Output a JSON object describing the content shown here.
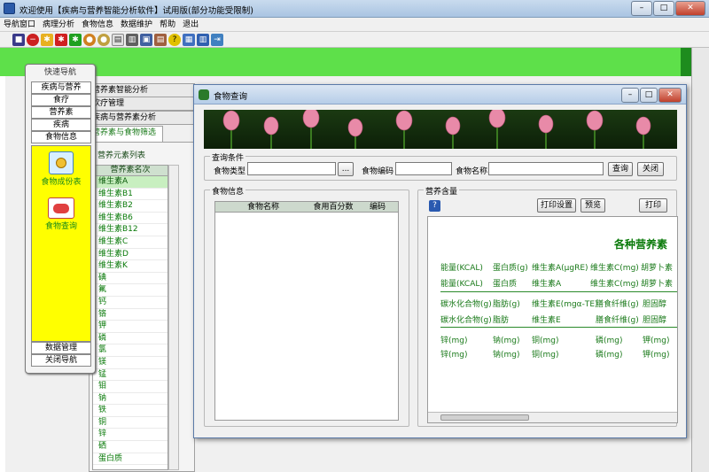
{
  "window": {
    "title": "欢迎使用【疾病与营养智能分析软件】试用版(部分功能受限制)"
  },
  "menu": [
    "导航窗口",
    "病理分析",
    "食物信息",
    "数据维护",
    "帮助",
    "退出"
  ],
  "background": {
    "tab1": "营养素智能分析",
    "tab2": "饮疗管理",
    "tab3": "疾病与营养素分析",
    "tab4": "营养素与食物筛选",
    "list_title": "营养元素列表",
    "list_header": "营养素名次",
    "items": [
      "维生素A",
      "维生素B1",
      "维生素B2",
      "维生素B6",
      "维生素B12",
      "维生素C",
      "维生素D",
      "维生素K",
      "碘",
      "氟",
      "钙",
      "铬",
      "钾",
      "磷",
      "氯",
      "镁",
      "锰",
      "钼",
      "钠",
      "铁",
      "铜",
      "锌",
      "硒",
      "蛋白质"
    ]
  },
  "quicknav": {
    "title": "快速导航",
    "sections": [
      "疾病与营养",
      "食疗",
      "营养素",
      "疾病",
      "食物信息"
    ],
    "items": [
      "食物成份表",
      "食物查询"
    ],
    "bottom": [
      "数据管理",
      "关闭导航"
    ]
  },
  "dialog": {
    "title": "食物查询",
    "query_group": "查询条件",
    "food_type_label": "食物类型",
    "browse_btn": "...",
    "food_code_label": "食物编码",
    "food_name_label": "食物名称",
    "query_btn": "查询",
    "close_btn": "关闭",
    "food_info_group": "食物信息",
    "grid_headers": [
      "食物名称",
      "食用百分数",
      "编码"
    ],
    "nutrient_group": "营养含量",
    "help_icon": "?",
    "print_settings_btn": "打印设置",
    "preview_btn": "预览",
    "print_btn": "打印",
    "panel_title": "各种营养素",
    "rows": [
      [
        "能量(KCAL)",
        "蛋白质(g)",
        "维生素A(μgRE)",
        "维生素C(mg)",
        "胡萝卜素"
      ],
      [
        "能量(KCAL)",
        "蛋白质",
        "维生素A",
        "维生素C(mg)",
        "胡萝卜素"
      ],
      [
        "碳水化合物(g)",
        "脂肪(g)",
        "维生素E(mgα-TE)",
        "膳食纤维(g)",
        "胆固醇"
      ],
      [
        "碳水化合物(g)",
        "脂肪",
        "维生素E",
        "膳食纤维(g)",
        "胆固醇"
      ],
      [
        "锌(mg)",
        "钠(mg)",
        "铜(mg)",
        "磷(mg)",
        "钾(mg)"
      ],
      [
        "锌(mg)",
        "钠(mg)",
        "铜(mg)",
        "磷(mg)",
        "钾(mg)"
      ]
    ]
  }
}
